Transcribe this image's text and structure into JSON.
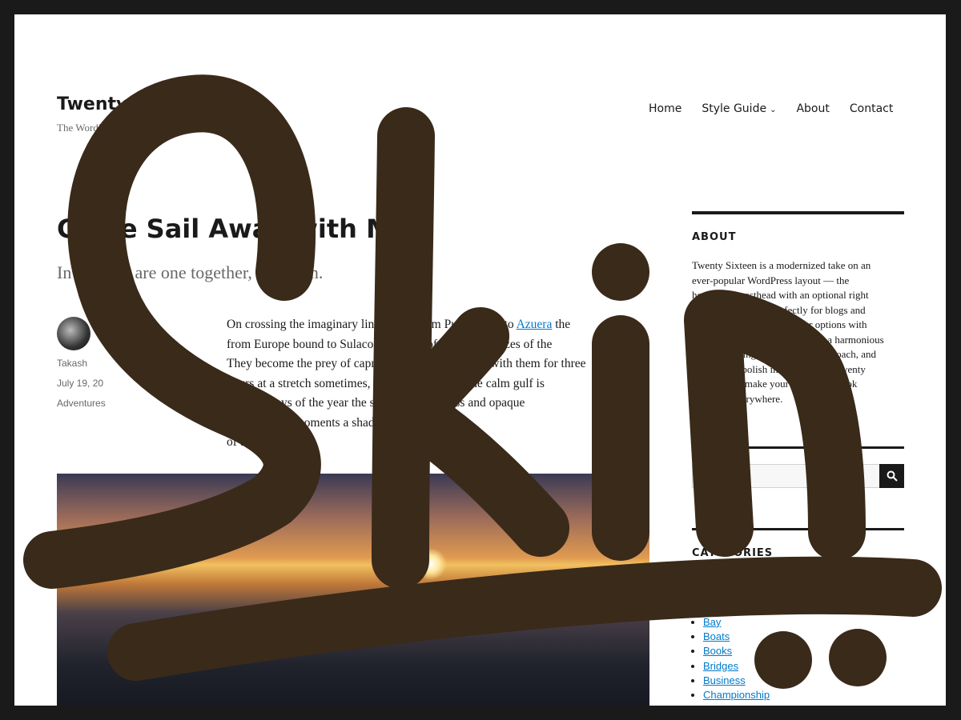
{
  "site": {
    "title": "Twenty Sixteen",
    "description": "The WordPress"
  },
  "nav": {
    "items": [
      "Home",
      "Style Guide",
      "About",
      "Contact"
    ]
  },
  "post": {
    "title": "Come Sail Away with Me",
    "summary": "In     ally, we are one     together,     an ocean.",
    "author": "Takash",
    "date": "July 19, 20",
    "category": "Adventures",
    "content_lines": [
      "On crossing the imaginary line drawn from Punta Mala to Azuera the",
      "from Europe bound to Sulaco lose sight of the land breezes of the",
      "They become the prey of capricious winds that sport with them for three",
      "hours at a stretch sometimes, and in the stead of the calm gulf is",
      "on most days of the year the sport of motionless and opaque",
      "the rare clear moments a shadow is cast upon the",
      "of the sea."
    ],
    "link_text": "Azuera"
  },
  "sidebar": {
    "about": {
      "title": "ABOUT",
      "text": "Twenty Sixteen is a modernized take on an ever-popular WordPress layout — the horizontal masthead with an optional right sidebar that works perfectly for blogs and websites. It has custom color options with beautiful default color schemes, a harmonious fluid grid using a mobile-first approach, and impeccable polish in every detail. Twenty Sixteen will make your WordPress look beautiful everywhere."
    },
    "search": {
      "placeholder": "",
      "icon": "search-icon"
    },
    "categories": {
      "title": "CATEGORIES",
      "items": [
        "Bay",
        "Boats",
        "Books",
        "Bridges",
        "Business",
        "Championship"
      ]
    }
  },
  "overlay": {
    "text": "Skin",
    "color": "#3a2a1a"
  },
  "colors": {
    "link": "#007acc",
    "text": "#1a1a1a",
    "muted": "#686868",
    "frame": "#1a1a1a"
  }
}
